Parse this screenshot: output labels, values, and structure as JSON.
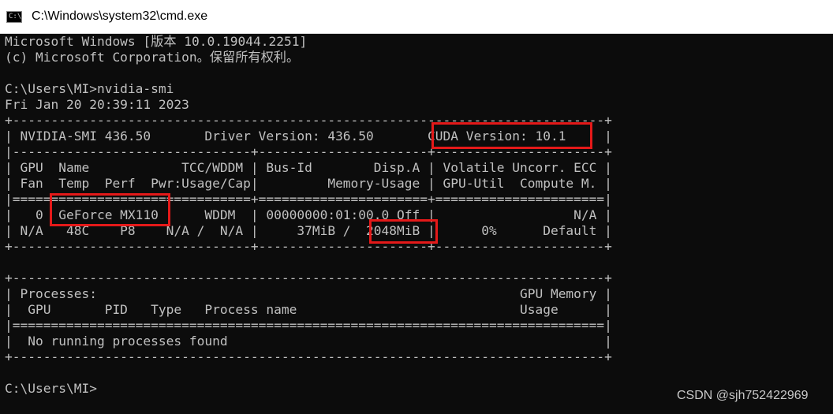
{
  "window": {
    "title": "C:\\Windows\\system32\\cmd.exe",
    "icon_glyph": "C:\\"
  },
  "console": {
    "lines": [
      "Microsoft Windows [版本 10.0.19044.2251]",
      "(c) Microsoft Corporation。保留所有权利。",
      "",
      "C:\\Users\\MI>nvidia-smi",
      "Fri Jan 20 20:39:11 2023",
      "+-----------------------------------------------------------------------------+",
      "| NVIDIA-SMI 436.50       Driver Version: 436.50       CUDA Version: 10.1     |",
      "|-------------------------------+----------------------+----------------------+",
      "| GPU  Name            TCC/WDDM | Bus-Id        Disp.A | Volatile Uncorr. ECC |",
      "| Fan  Temp  Perf  Pwr:Usage/Cap|         Memory-Usage | GPU-Util  Compute M. |",
      "|===============================+======================+======================|",
      "|   0  GeForce MX110      WDDM  | 00000000:01:00.0 Off |                  N/A |",
      "| N/A   48C    P8    N/A /  N/A |     37MiB /  2048MiB |      0%      Default |",
      "+-------------------------------+----------------------+----------------------+",
      "",
      "+-----------------------------------------------------------------------------+",
      "| Processes:                                                       GPU Memory |",
      "|  GPU       PID   Type   Process name                             Usage      |",
      "|=============================================================================|",
      "|  No running processes found                                                 |",
      "+-----------------------------------------------------------------------------+",
      "",
      "C:\\Users\\MI>"
    ]
  },
  "watermark": "CSDN @sjh752422969",
  "colors": {
    "console_bg": "#0c0c0c",
    "console_text": "#c0c0c0",
    "highlight_border": "#e41919",
    "titlebar_bg": "#ffffff"
  }
}
